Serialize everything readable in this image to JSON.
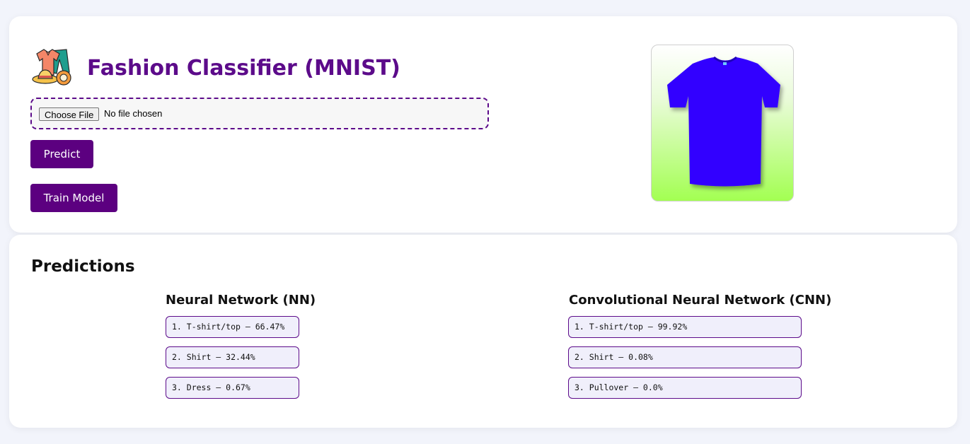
{
  "header": {
    "title": "Fashion Classifier (MNIST)",
    "logo_icon": "clothing-icon"
  },
  "upload": {
    "button_label": "Choose File",
    "status_text": "No file chosen"
  },
  "actions": {
    "predict_label": "Predict",
    "train_label": "Train Model"
  },
  "preview": {
    "icon": "tshirt-icon",
    "shirt_color": "#3300ff"
  },
  "predictions": {
    "title": "Predictions",
    "nn": {
      "title": "Neural Network (NN)",
      "items": [
        "1. T-shirt/top — 66.47%",
        "2. Shirt — 32.44%",
        "3. Dress — 0.67%"
      ]
    },
    "cnn": {
      "title": "Convolutional Neural Network (CNN)",
      "items": [
        "1. T-shirt/top — 99.92%",
        "2. Shirt — 0.08%",
        "3. Pullover — 0.0%"
      ]
    }
  },
  "colors": {
    "accent": "#5c0080",
    "title": "#5c0b8a",
    "page_bg": "#f2f4fb",
    "item_bg": "#f0effb"
  }
}
